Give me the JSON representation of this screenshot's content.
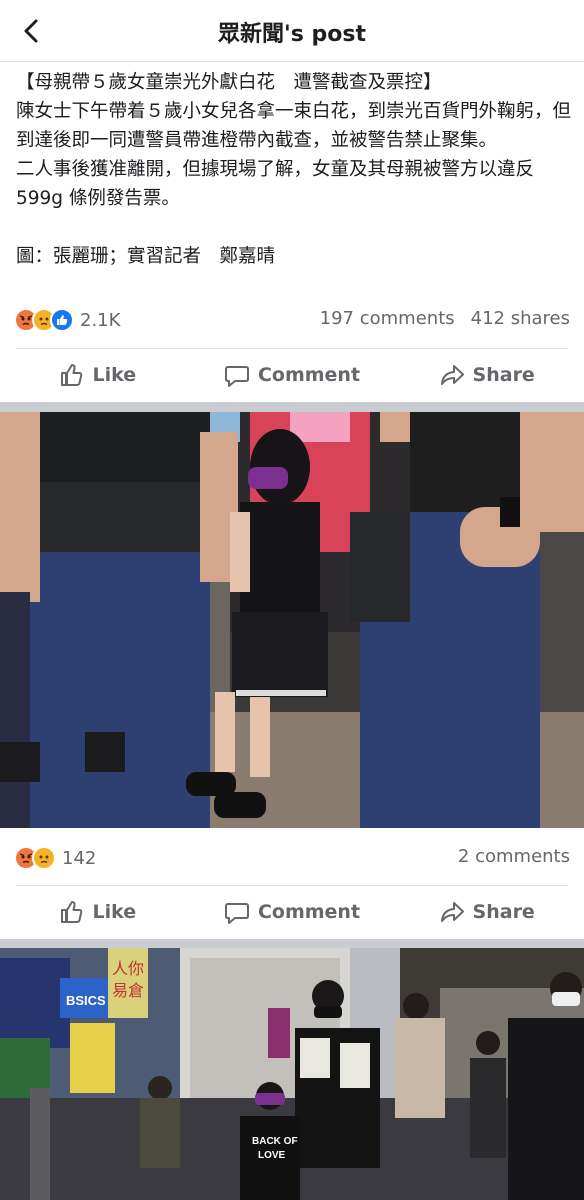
{
  "header": {
    "title": "眾新聞's post"
  },
  "post": {
    "lines": [
      "【母親帶５歲女童崇光外獻白花　遭警截查及票控】",
      "陳女士下午帶着５歲小女兒各拿一束白花，到崇光百貨門外鞠躬，但到達後即一同遭警員帶進橙帶內截查，並被警告禁止聚集。",
      "二人事後獲准離開，但據現場了解，女童及其母親被警方以違反 599g 條例發告票。",
      "圖：張麗珊；實習記者　鄭嘉晴"
    ],
    "reaction_count": "2.1K",
    "comments": "197 comments",
    "shares": "412 shares",
    "reaction_icons": [
      "angry-icon",
      "sad-icon",
      "like-icon"
    ]
  },
  "actions": {
    "like": "Like",
    "comment": "Comment",
    "share": "Share"
  },
  "photo1": {
    "reaction_count": "142",
    "comments": "2 comments",
    "reaction_icons": [
      "angry-icon",
      "sad-icon"
    ],
    "shirt_text": "",
    "description_colors": {
      "uniform": "#2e3f72",
      "vest": "#1d1f22",
      "shirt": "#8fb8d8",
      "mask": "#7b2f8e"
    }
  },
  "photo2": {
    "sign_text_1": "人你",
    "sign_text_2": "易倉",
    "shirt_text": "BACK OF",
    "shirt_text_2": "LOVE",
    "store_text": "BSICS"
  },
  "colors": {
    "angry": "#f0773b",
    "sad": "#f7b125",
    "like": "#1877f2",
    "gray": "#65676b",
    "separator": "#c9ccd1"
  }
}
